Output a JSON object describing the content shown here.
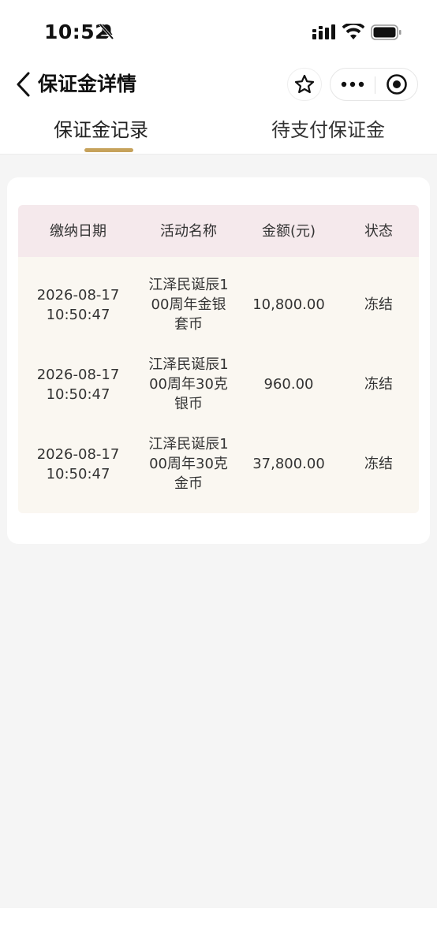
{
  "status_bar": {
    "time": "10:52"
  },
  "nav": {
    "title": "保证金详情"
  },
  "tabs": [
    {
      "label": "保证金记录",
      "active": true
    },
    {
      "label": "待支付保证金",
      "active": false
    }
  ],
  "table": {
    "headers": [
      "缴纳日期",
      "活动名称",
      "金额(元)",
      "状态"
    ],
    "rows": [
      {
        "date": "2026-08-17",
        "time": "10:50:47",
        "name": "江泽民诞辰100周年金银套币",
        "amount": "10,800.00",
        "status": "冻结"
      },
      {
        "date": "2026-08-17",
        "time": "10:50:47",
        "name": "江泽民诞辰100周年30克银币",
        "amount": "960.00",
        "status": "冻结"
      },
      {
        "date": "2026-08-17",
        "time": "10:50:47",
        "name": "江泽民诞辰100周年30克金币",
        "amount": "37,800.00",
        "status": "冻结"
      }
    ]
  },
  "colors": {
    "accent": "#c6a25b",
    "header_bg": "#f5e9ec",
    "body_bg": "#faf7f1",
    "page_bg": "#f5f5f5"
  },
  "icons": {
    "back": "chevron-left-icon",
    "star": "star-icon",
    "more": "more-dots-icon",
    "close": "target-circle-icon",
    "silent": "bell-off-icon",
    "signal": "signal-icon",
    "wifi": "wifi-icon",
    "battery": "battery-icon"
  }
}
